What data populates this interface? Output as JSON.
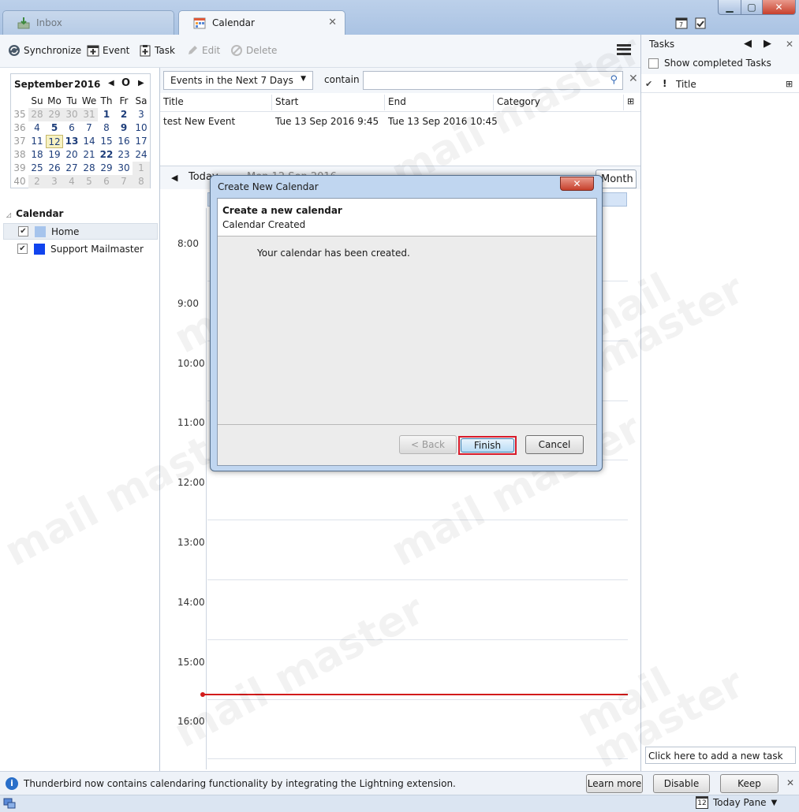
{
  "tabs": {
    "inbox": "Inbox",
    "calendar": "Calendar"
  },
  "toolbar": {
    "synchronize": "Synchronize",
    "event": "Event",
    "task": "Task",
    "edit": "Edit",
    "delete": "Delete"
  },
  "minical": {
    "month": "September",
    "year": "2016",
    "weekdays": [
      "Su",
      "Mo",
      "Tu",
      "We",
      "Th",
      "Fr",
      "Sa"
    ],
    "weeks": [
      {
        "wk": "35",
        "days": [
          "28",
          "29",
          "30",
          "31",
          "1",
          "2",
          "3"
        ]
      },
      {
        "wk": "36",
        "days": [
          "4",
          "5",
          "6",
          "7",
          "8",
          "9",
          "10"
        ]
      },
      {
        "wk": "37",
        "days": [
          "11",
          "12",
          "13",
          "14",
          "15",
          "16",
          "17"
        ]
      },
      {
        "wk": "38",
        "days": [
          "18",
          "19",
          "20",
          "21",
          "22",
          "23",
          "24"
        ]
      },
      {
        "wk": "39",
        "days": [
          "25",
          "26",
          "27",
          "28",
          "29",
          "30",
          "1"
        ]
      },
      {
        "wk": "40",
        "days": [
          "2",
          "3",
          "4",
          "5",
          "6",
          "7",
          "8"
        ]
      }
    ]
  },
  "calendars": {
    "heading": "Calendar",
    "items": [
      {
        "name": "Home",
        "color": "#a6c4ec"
      },
      {
        "name": "Support Mailmaster",
        "color": "#1144ee"
      }
    ]
  },
  "filter": {
    "selected": "Events in the Next 7 Days",
    "contain": "contain"
  },
  "events": {
    "columns": [
      "Title",
      "Start",
      "End",
      "Category"
    ],
    "rows": [
      {
        "title": "test New Event",
        "start": "Tue 13 Sep 2016 9:45",
        "end": "Tue 13 Sep 2016 10:45",
        "category": ""
      }
    ]
  },
  "daynav": {
    "today": "Today",
    "date": "Mon 12 Sep 2016",
    "month": "Month"
  },
  "hours": [
    "8:00",
    "9:00",
    "10:00",
    "11:00",
    "12:00",
    "13:00",
    "14:00",
    "15:00",
    "16:00"
  ],
  "tasks": {
    "title": "Tasks",
    "show_completed": "Show completed Tasks",
    "column_title": "Title",
    "new_task_placeholder": "Click here to add a new task"
  },
  "dialog": {
    "window_title": "Create New Calendar",
    "header": "Create a new calendar",
    "subheader": "Calendar Created",
    "message": "Your calendar has been created.",
    "back": "< Back",
    "finish": "Finish",
    "cancel": "Cancel"
  },
  "notification": {
    "message": "Thunderbird now contains calendaring functionality by integrating the Lightning extension.",
    "learn_more": "Learn more",
    "disable": "Disable",
    "keep": "Keep"
  },
  "status": {
    "today_pane": "Today Pane",
    "today_icon_day": "12"
  },
  "watermark": "mail master"
}
